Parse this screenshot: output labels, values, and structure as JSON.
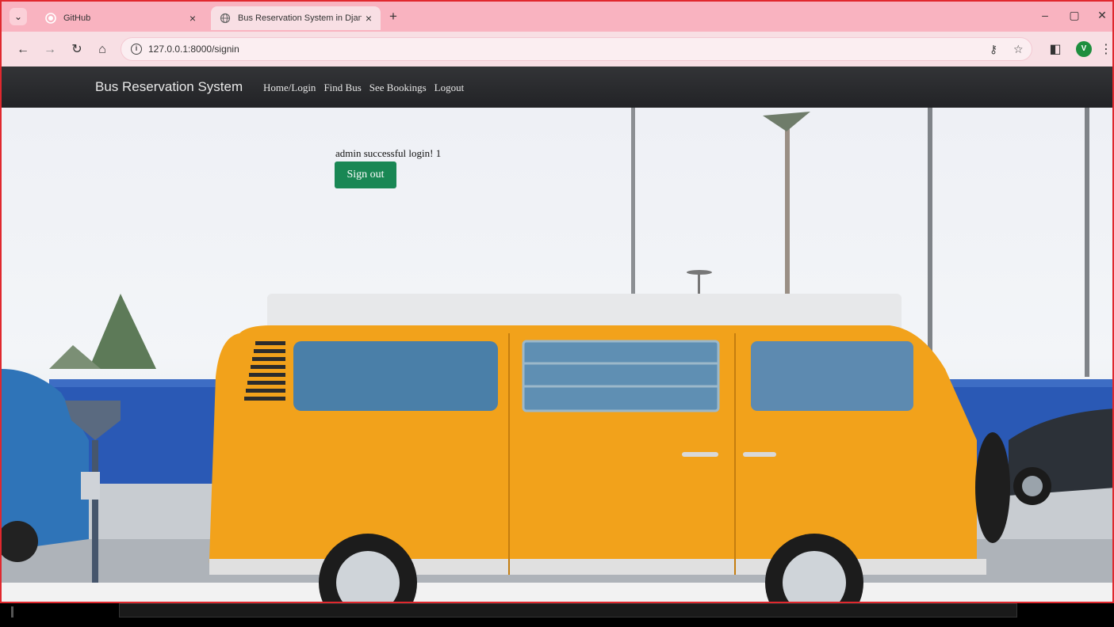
{
  "browser": {
    "tabs": [
      {
        "title": "GitHub",
        "icon": "github-icon",
        "active": false
      },
      {
        "title": "Bus Reservation System in Djan",
        "icon": "globe-icon",
        "active": true
      }
    ],
    "new_tab_label": "+",
    "url": "127.0.0.1:8000/signin",
    "profile_initial": "V"
  },
  "app": {
    "brand": "Bus Reservation System",
    "nav": [
      "Home/Login",
      "Find Bus",
      "See Bookings",
      "Logout"
    ],
    "message": "admin successful login! 1",
    "signout_label": "Sign out"
  },
  "colors": {
    "accent_button": "#198754",
    "navbar": "#2a2b2e",
    "tab_strip": "#f9b3c0",
    "van": "#f2a21b",
    "window_border": "#e0282e"
  }
}
